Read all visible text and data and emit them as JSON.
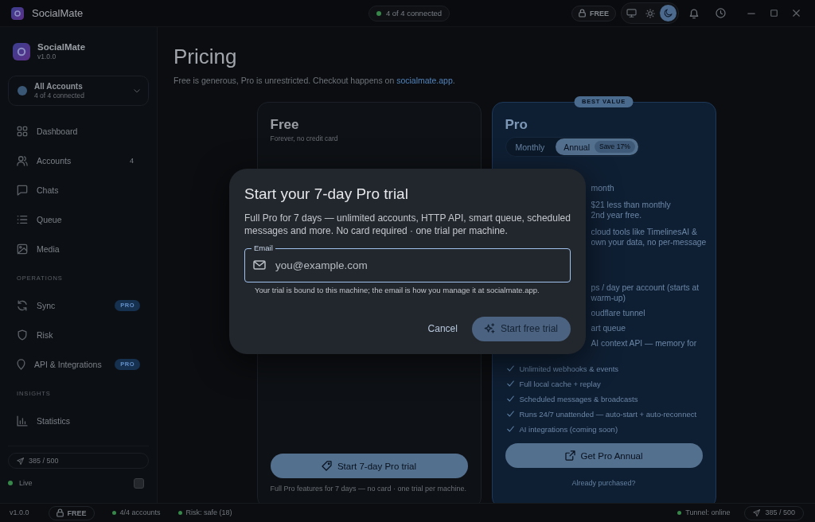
{
  "title_bar": {
    "app_name": "SocialMate",
    "connection": {
      "text": "4 of 4 connected",
      "color": "#37874a"
    },
    "plan": "FREE",
    "theme_switch": [
      {
        "selected": false
      },
      {
        "selected": false
      },
      {
        "selected": true
      }
    ]
  },
  "sidebar": {
    "app_name": "SocialMate",
    "version": "v1.0.0",
    "account_switcher": {
      "title": "All Accounts",
      "subtitle": "4 of 4 connected"
    },
    "sections": [
      {
        "items": [
          {
            "label": "Dashboard",
            "selected": false
          },
          {
            "label": "Accounts",
            "selected": false,
            "badge": {
              "kind": "count",
              "text": "4"
            }
          },
          {
            "label": "Chats",
            "selected": false
          },
          {
            "label": "Queue",
            "selected": false
          },
          {
            "label": "Media",
            "selected": false
          }
        ]
      },
      {
        "heading": "OPERATIONS",
        "items": [
          {
            "label": "Sync",
            "selected": false,
            "badge": {
              "kind": "pro",
              "text": "PRO"
            }
          },
          {
            "label": "Risk",
            "selected": false
          },
          {
            "label": "API & Integrations",
            "selected": false,
            "badge": {
              "kind": "pro",
              "text": "PRO"
            }
          }
        ]
      },
      {
        "heading": "INSIGHTS",
        "items": [
          {
            "label": "Statistics",
            "selected": false
          }
        ]
      }
    ],
    "usage": "385 / 500",
    "live": {
      "text": "Live",
      "color": "#37874a"
    }
  },
  "page": {
    "title": "Pricing",
    "subtitle": {
      "text": "Free is generous, Pro is unrestricted. Checkout happens on ",
      "link": "socialmate.app",
      "end": "."
    },
    "plans": [
      {
        "name": "Free",
        "featured": false,
        "tagline": "Forever, no credit card",
        "button": "Start 7-day Pro trial",
        "note": "Full Pro features for 7 days — no card · one trial per machine."
      },
      {
        "name": "Pro",
        "featured": true,
        "ribbon": "BEST VALUE",
        "billing": [
          {
            "label": "Monthly",
            "selected": false
          },
          {
            "label": "Annual",
            "badge": "Save 17%",
            "selected": true
          }
        ],
        "price_fragment": "month",
        "savings_fragments": [
          "$21 less than monthly",
          "2nd year free."
        ],
        "description_fragments": [
          "cloud tools like TimelinesAI &",
          "own your data, no per-message"
        ],
        "features": [
          {
            "kind": "partial",
            "lines": [
              "ps / day per account (starts at",
              "warm-up)"
            ]
          },
          {
            "kind": "partial",
            "lines": [
              "oudflare tunnel"
            ]
          },
          {
            "kind": "partial",
            "lines": [
              "art queue"
            ]
          },
          {
            "kind": "partial",
            "lines": [
              "AI context API — memory for"
            ]
          },
          {
            "kind": "check",
            "text": "Unlimited webhooks & events"
          },
          {
            "kind": "check",
            "text": "Full local cache + replay"
          },
          {
            "kind": "check",
            "text": "Scheduled messages & broadcasts"
          },
          {
            "kind": "check",
            "text": "Runs 24/7 unattended — auto-start + auto-reconnect"
          },
          {
            "kind": "check",
            "text": "AI integrations (coming soon)"
          }
        ],
        "button": "Get Pro Annual",
        "footer": "Already purchased?"
      }
    ]
  },
  "status_bar": {
    "version": "v1.0.0",
    "plan": "FREE",
    "left_indicators": [
      {
        "text": "4/4 accounts",
        "color": "#37874a"
      },
      {
        "text": "Risk: safe (18)",
        "color": "#37874a"
      }
    ],
    "right_indicators": [
      {
        "text": "Tunnel: online",
        "color": "#37874a"
      }
    ],
    "usage": "385 / 500"
  },
  "dialog": {
    "title": "Start your 7-day Pro trial",
    "description": "Full Pro for 7 days — unlimited accounts, HTTP API, smart queue, scheduled messages and more. No card required · one trial per machine.",
    "email_field": {
      "label": "Email",
      "placeholder": "you@example.com"
    },
    "helper": "Your trial is bound to this machine; the email is how you manage it at socialmate.app.",
    "buttons": [
      {
        "kind": "text",
        "label": "Cancel",
        "disabled": false
      },
      {
        "kind": "primary",
        "label": "Start free trial",
        "disabled": true
      }
    ]
  }
}
